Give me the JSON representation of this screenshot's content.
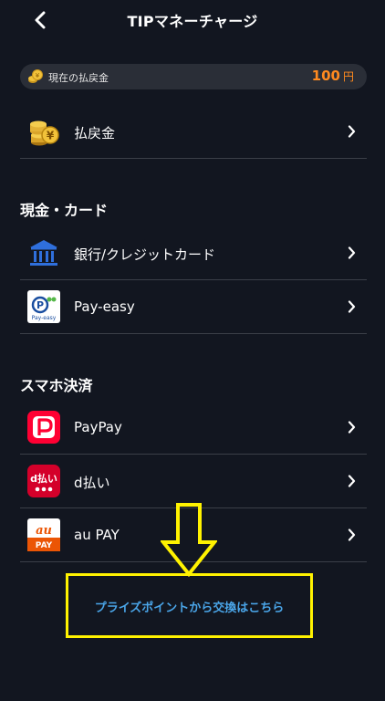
{
  "header": {
    "title": "TIPマネーチャージ",
    "back_icon": "chevron-left-icon"
  },
  "balance": {
    "label": "現在の払戻金",
    "amount": "100",
    "unit": "円",
    "amount_color": "#ff8a1f"
  },
  "refund": {
    "label": "払戻金"
  },
  "sections": {
    "cash_card": {
      "title": "現金・カード",
      "items": [
        {
          "label": "銀行/クレジットカード",
          "icon": "bank-icon"
        },
        {
          "label": "Pay-easy",
          "icon": "pay-easy-icon"
        }
      ]
    },
    "smartphone": {
      "title": "スマホ決済",
      "items": [
        {
          "label": "PayPay",
          "icon": "paypay-icon"
        },
        {
          "label": "d払い",
          "icon": "d-barai-icon"
        },
        {
          "label": "au PAY",
          "icon": "au-pay-icon"
        }
      ]
    }
  },
  "exchange_link": "プライズポイントから交換はこちら",
  "colors": {
    "background": "#121620",
    "link": "#4aa5e8",
    "highlight": "#fff200"
  }
}
